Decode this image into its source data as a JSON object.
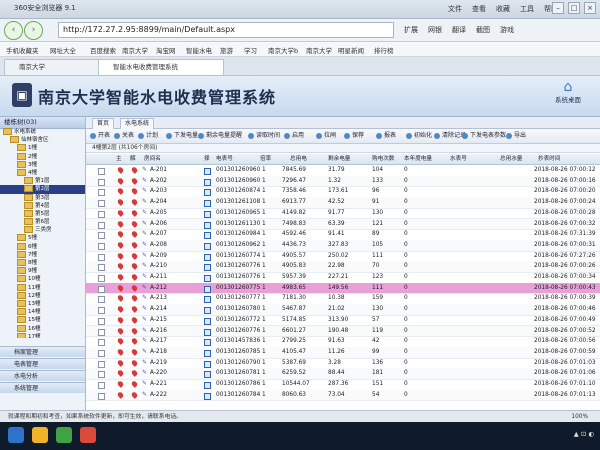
{
  "browser": {
    "app_name": "360安全浏览器 9.1",
    "menu": [
      "文件",
      "查看",
      "收藏",
      "工具",
      "帮助"
    ],
    "url": "http://172.27.2.95:8899/main/Default.aspx",
    "tools": [
      "扩展",
      "网银",
      "翻译",
      "截图",
      "游戏"
    ],
    "favorites": [
      "手机收藏夹",
      "网址大全",
      "百度搜索",
      "南京大学",
      "淘宝网",
      "智能水电",
      "旅游",
      "学习",
      "南京大学b",
      "南京大学",
      "明星新闻",
      "排行榜"
    ],
    "tabs": [
      "南京大学",
      "智能水电收费管理系统"
    ]
  },
  "header": {
    "title": "南京大学智能水电收费管理系统",
    "home_label": "系统桌面"
  },
  "sidebar": {
    "head": "楼栋树(03)",
    "tree": [
      "水电系统",
      "仙林宿舍区",
      "1幢",
      "2幢",
      "3幢",
      "4幢",
      "第1层",
      "第2层",
      "第3层",
      "第4层",
      "第5层",
      "第6层",
      "三类房",
      "5幢",
      "6幢",
      "7幢",
      "8幢",
      "9幢",
      "10幢",
      "11幢",
      "12幢",
      "13幢",
      "14幢",
      "15幢",
      "16幢",
      "17幢"
    ],
    "selected_index": 7,
    "accordion": [
      "档案管理",
      "电表管理",
      "水电分析",
      "系统管理"
    ]
  },
  "content": {
    "tabs": [
      "首页",
      "水电系统"
    ],
    "toolbar": [
      "开表",
      "关表",
      "计划",
      "下发电量",
      "剩余电量提醒",
      "读取时间",
      "启用",
      "拉闸",
      "保荐",
      "报表",
      "初始化",
      "清除记录",
      "下发电表参数",
      "导出"
    ],
    "crumb": "4幢第2层 (共106个房间)",
    "columns": [
      "主",
      "解",
      "房间名",
      "择",
      "电表号",
      "倍率",
      "总用电",
      "剩余电量",
      "购电次数",
      "本年度电量",
      "水表号",
      "总用水量",
      "抄表时间"
    ],
    "rows": [
      {
        "room": "A-201",
        "meter": "001301260960",
        "rate": "1",
        "total": "7845.69",
        "remain": "31.79",
        "buys": "104",
        "year": "0",
        "time": "2018-08-26 07:00:12"
      },
      {
        "room": "A-202",
        "meter": "001301260960",
        "rate": "1",
        "total": "7296.47",
        "remain": "1.32",
        "buys": "133",
        "year": "0",
        "time": "2018-08-26 07:00:16"
      },
      {
        "room": "A-203",
        "meter": "001301260874",
        "rate": "1",
        "total": "7358.46",
        "remain": "173.61",
        "buys": "96",
        "year": "0",
        "time": "2018-08-26 07:00:20"
      },
      {
        "room": "A-204",
        "meter": "001301261108",
        "rate": "1",
        "total": "6913.77",
        "remain": "42.52",
        "buys": "91",
        "year": "0",
        "time": "2018-08-26 07:00:24"
      },
      {
        "room": "A-205",
        "meter": "001301260965",
        "rate": "1",
        "total": "4149.82",
        "remain": "91.77",
        "buys": "130",
        "year": "0",
        "time": "2018-08-26 07:00:28"
      },
      {
        "room": "A-206",
        "meter": "001301261130",
        "rate": "1",
        "total": "7498.83",
        "remain": "63.39",
        "buys": "121",
        "year": "0",
        "time": "2018-08-26 07:00:32"
      },
      {
        "room": "A-207",
        "meter": "001301260984",
        "rate": "1",
        "total": "4592.46",
        "remain": "91.41",
        "buys": "89",
        "year": "0",
        "time": "2018-08-26 07:31:39"
      },
      {
        "room": "A-208",
        "meter": "001301260962",
        "rate": "1",
        "total": "4436.73",
        "remain": "327.83",
        "buys": "105",
        "year": "0",
        "time": "2018-08-26 07:00:31"
      },
      {
        "room": "A-209",
        "meter": "001301260774",
        "rate": "1",
        "total": "4905.57",
        "remain": "250.02",
        "buys": "111",
        "year": "0",
        "time": "2018-08-26 07:27:26"
      },
      {
        "room": "A-210",
        "meter": "001301260776",
        "rate": "1",
        "total": "4905.83",
        "remain": "22.98",
        "buys": "70",
        "year": "0",
        "time": "2018-08-26 07:00:26"
      },
      {
        "room": "A-211",
        "meter": "001301260776",
        "rate": "1",
        "total": "5957.39",
        "remain": "227.21",
        "buys": "123",
        "year": "0",
        "time": "2018-08-26 07:00:34"
      },
      {
        "room": "A-212",
        "meter": "001301260775",
        "rate": "1",
        "total": "4983.65",
        "remain": "149.56",
        "buys": "111",
        "year": "0",
        "time": "2018-08-26 07:00:43"
      },
      {
        "room": "A-213",
        "meter": "001301260777",
        "rate": "1",
        "total": "7181.30",
        "remain": "10.38",
        "buys": "159",
        "year": "0",
        "time": "2018-08-26 07:00:39"
      },
      {
        "room": "A-214",
        "meter": "001301260780",
        "rate": "1",
        "total": "5467.87",
        "remain": "21.02",
        "buys": "130",
        "year": "0",
        "time": "2018-08-26 07:00:46"
      },
      {
        "room": "A-215",
        "meter": "001301260772",
        "rate": "1",
        "total": "5174.85",
        "remain": "313.90",
        "buys": "57",
        "year": "0",
        "time": "2018-08-26 07:00:49"
      },
      {
        "room": "A-216",
        "meter": "001301260776",
        "rate": "1",
        "total": "6601.27",
        "remain": "190.48",
        "buys": "119",
        "year": "0",
        "time": "2018-08-26 07:00:52"
      },
      {
        "room": "A-217",
        "meter": "001301457836",
        "rate": "1",
        "total": "2799.25",
        "remain": "91.63",
        "buys": "42",
        "year": "0",
        "time": "2018-08-26 07:00:56"
      },
      {
        "room": "A-218",
        "meter": "001301260785",
        "rate": "1",
        "total": "4105.47",
        "remain": "11.26",
        "buys": "99",
        "year": "0",
        "time": "2018-08-26 07:00:59"
      },
      {
        "room": "A-219",
        "meter": "001301260790",
        "rate": "1",
        "total": "5387.69",
        "remain": "3.28",
        "buys": "136",
        "year": "0",
        "time": "2018-08-26 07:01:03"
      },
      {
        "room": "A-220",
        "meter": "001301260781",
        "rate": "1",
        "total": "6259.52",
        "remain": "88.44",
        "buys": "181",
        "year": "0",
        "time": "2018-08-26 07:01:06"
      },
      {
        "room": "A-221",
        "meter": "001301260786",
        "rate": "1",
        "total": "10544.07",
        "remain": "287.36",
        "buys": "151",
        "year": "0",
        "time": "2018-08-26 07:01:10"
      },
      {
        "room": "A-222",
        "meter": "001301260784",
        "rate": "1",
        "total": "8060.63",
        "remain": "73.04",
        "buys": "54",
        "year": "0",
        "time": "2018-08-26 07:01:13"
      }
    ],
    "highlight_index": 11
  },
  "statusbar": {
    "text": "就课程和期初和考查，如果系统软件更新，即可生效，请联系电话。",
    "zoom": "100%"
  },
  "colors": {
    "highlight": "#e9a0d8",
    "tree_selected": "#2a3f88",
    "title": "#1e2f4f"
  }
}
